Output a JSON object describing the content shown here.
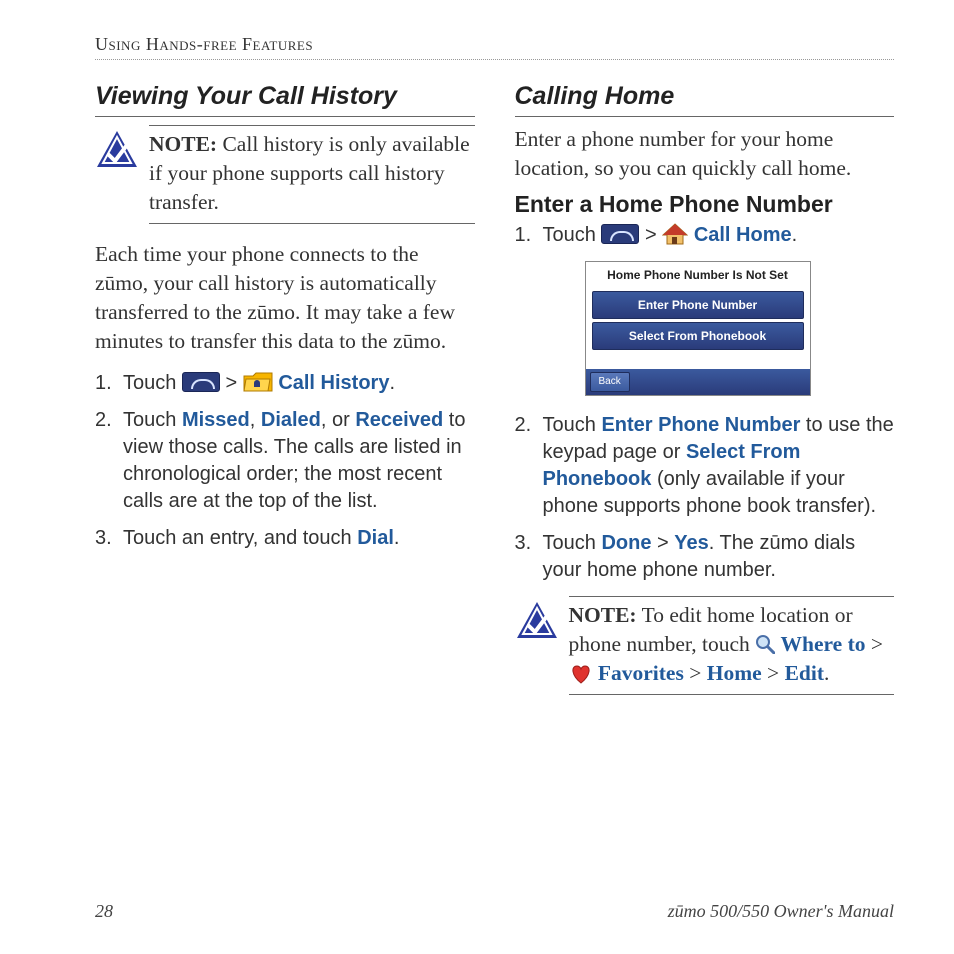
{
  "running_head": "Using Hands-free Features",
  "left": {
    "heading": "Viewing Your Call History",
    "note_label": "NOTE:",
    "note_body": " Call history is only available if your phone supports call history transfer.",
    "para": "Each time your phone connects to the zūmo, your call history is automatically transferred to the zūmo. It may take a few minutes to transfer this data to the zūmo.",
    "step1_prefix": "Touch ",
    "step1_link": "Call History",
    "step2_a": "Touch ",
    "step2_missed": "Missed",
    "step2_sep1": ", ",
    "step2_dialed": "Dialed",
    "step2_sep2": ", or ",
    "step2_received": "Received",
    "step2_tail": " to view those calls. The calls are listed in chronological order; the most recent calls are at the top of the list.",
    "step3_a": "Touch an entry, and touch ",
    "step3_dial": "Dial",
    "period": "."
  },
  "right": {
    "heading": "Calling Home",
    "intro": "Enter a phone number for your home location, so you can quickly call home.",
    "subheading": "Enter a Home Phone Number",
    "step1_prefix": "Touch ",
    "step1_link": "Call Home",
    "screenshot": {
      "title": "Home Phone Number Is Not Set",
      "btn1": "Enter Phone Number",
      "btn2": "Select From Phonebook",
      "back": "Back"
    },
    "step2_a": "Touch ",
    "step2_enter": "Enter Phone Number",
    "step2_mid": " to use the keypad page or ",
    "step2_select": "Select From Phonebook",
    "step2_tail": " (only available if your phone supports phone book transfer).",
    "step3_a": "Touch ",
    "step3_done": "Done",
    "step3_gt": " > ",
    "step3_yes": "Yes",
    "step3_tail": ". The zūmo dials your home phone number.",
    "note_label": "NOTE:",
    "note_body1": " To edit home location or phone number, touch ",
    "note_where": "Where to",
    "note_gt1": " > ",
    "note_fav": "Favorites",
    "note_gt2": " > ",
    "note_home": "Home",
    "note_gt3": " > ",
    "note_edit": "Edit",
    "period": "."
  },
  "footer": {
    "page": "28",
    "title": "zūmo 500/550 Owner's Manual"
  }
}
